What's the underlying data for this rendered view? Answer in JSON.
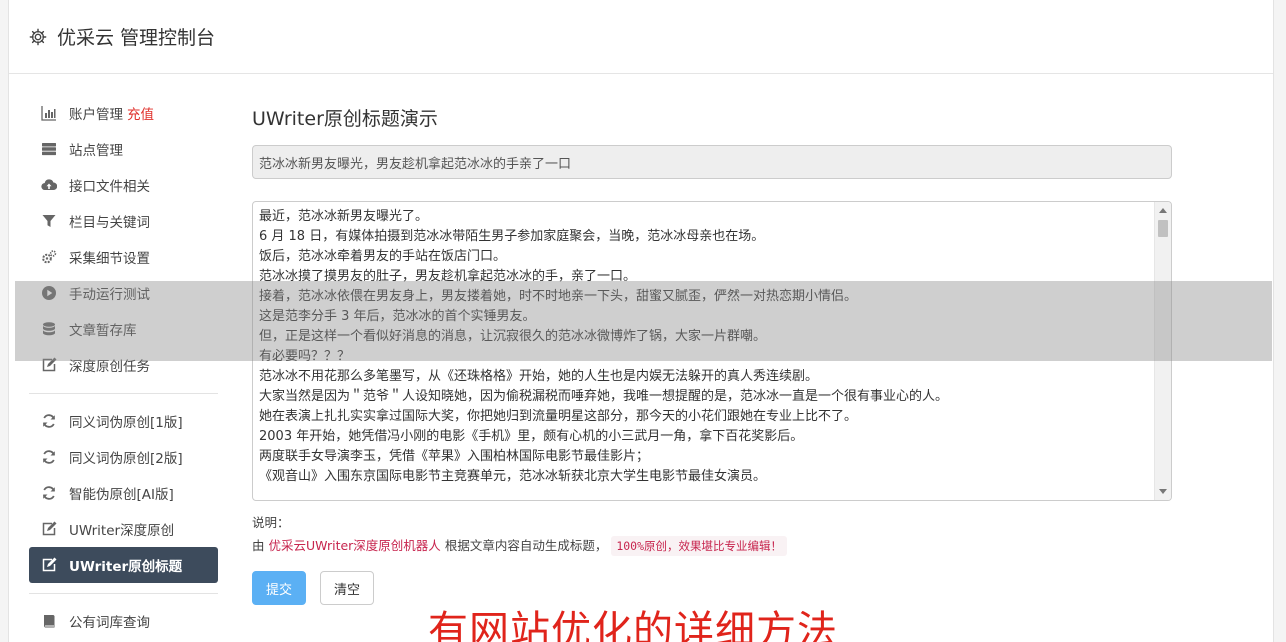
{
  "header": {
    "title": "优采云 管理控制台"
  },
  "sidebar": {
    "group1": [
      {
        "label": "账户管理",
        "accent": "充值",
        "icon": "bar-chart-icon"
      },
      {
        "label": "站点管理",
        "icon": "server-icon"
      },
      {
        "label": "接口文件相关",
        "icon": "cloud-upload-icon"
      },
      {
        "label": "栏目与关键词",
        "icon": "filter-icon"
      },
      {
        "label": "采集细节设置",
        "icon": "cogs-icon"
      },
      {
        "label": "手动运行测试",
        "icon": "play-circle-icon"
      },
      {
        "label": "文章暂存库",
        "icon": "database-icon"
      },
      {
        "label": "深度原创任务",
        "icon": "edit-icon"
      }
    ],
    "group2": [
      {
        "label": "同义词伪原创[1版]",
        "icon": "refresh-icon"
      },
      {
        "label": "同义词伪原创[2版]",
        "icon": "refresh-icon"
      },
      {
        "label": "智能伪原创[AI版]",
        "icon": "refresh-icon"
      },
      {
        "label": "UWriter深度原创",
        "icon": "edit-icon"
      },
      {
        "label": "UWriter原创标题",
        "icon": "edit-icon",
        "active": true
      }
    ],
    "group3": [
      {
        "label": "公有词库查询",
        "icon": "book-icon"
      }
    ]
  },
  "main": {
    "heading": "UWriter原创标题演示",
    "title_value": "范冰冰新男友曝光，男友趁机拿起范冰冰的手亲了一口",
    "content_lines": [
      "最近，范冰冰新男友曝光了。",
      "6 月 18 日，有媒体拍摄到范冰冰带陌生男子参加家庭聚会，当晚，范冰冰母亲也在场。",
      "饭后，范冰冰牵着男友的手站在饭店门口。",
      "范冰冰摸了摸男友的肚子，男友趁机拿起范冰冰的手，亲了一口。",
      "接着，范冰冰依偎在男友身上，男友搂着她，时不时地亲一下头，甜蜜又腻歪，俨然一对热恋期小情侣。",
      "这是范李分手 3 年后，范冰冰的首个实锤男友。",
      "但，正是这样一个看似好消息的消息，让沉寂很久的范冰冰微博炸了锅，大家一片群嘲。",
      "有必要吗？？？",
      "范冰冰不用花那么多笔墨写，从《还珠格格》开始，她的人生也是内娱无法躲开的真人秀连续剧。",
      "大家当然是因为＂范爷＂人设知晓她，因为偷税漏税而唾弃她，我唯一想提醒的是，范冰冰一直是一个很有事业心的人。",
      "她在表演上扎扎实实拿过国际大奖，你把她归到流量明星这部分，那今天的小花们跟她在专业上比不了。",
      "2003 年开始，她凭借冯小刚的电影《手机》里，颇有心机的小三武月一角，拿下百花奖影后。",
      "两度联手女导演李玉，凭借《苹果》入围柏林国际电影节最佳影片；",
      "《观音山》入围东京国际电影节主竞赛单元，范冰冰斩获北京大学生电影节最佳女演员。"
    ],
    "note_label": "说明：",
    "note_prefix": "由",
    "note_brand": "优采云UWriter深度原创机器人",
    "note_middle": "根据文章内容自动生成标题，",
    "note_code": "100%原创，效果堪比专业编辑！",
    "submit_label": "提交",
    "clear_label": "清空"
  },
  "watermark": "有网站优化的详细方法"
}
